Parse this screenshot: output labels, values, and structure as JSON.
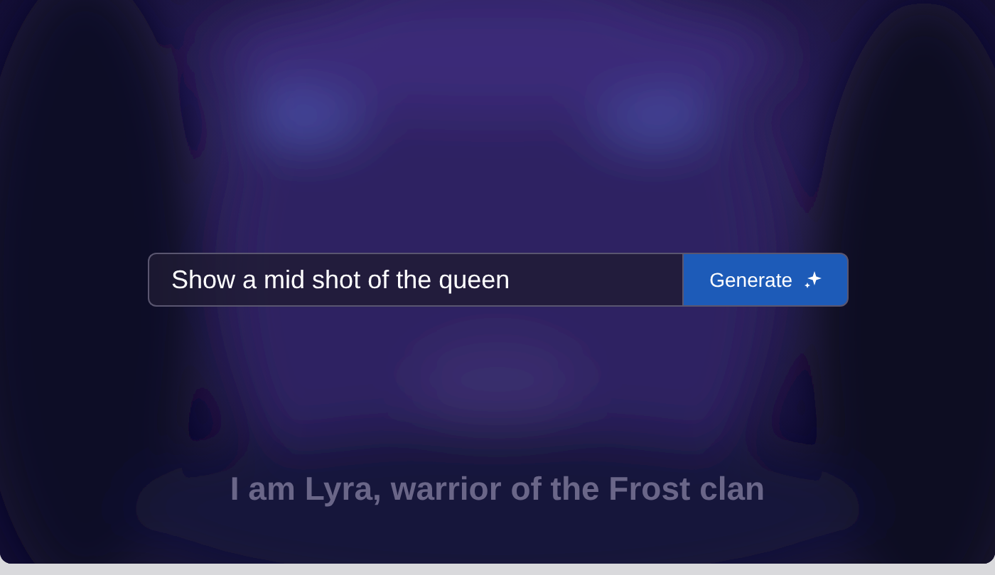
{
  "prompt": {
    "value": "Show a mid shot of the queen"
  },
  "generate_button": {
    "label": "Generate"
  },
  "caption": "I am Lyra, warrior of the Frost clan"
}
